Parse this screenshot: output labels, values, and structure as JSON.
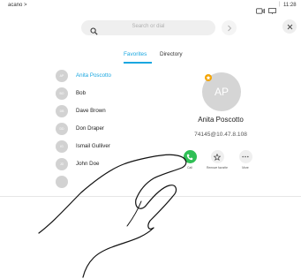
{
  "status_bar": {
    "brand": "acano >",
    "separator": "|",
    "time": "11:28"
  },
  "search": {
    "placeholder": "Search or dial"
  },
  "tabs": [
    {
      "label": "Favorites",
      "active": true
    },
    {
      "label": "Directory",
      "active": false
    }
  ],
  "contacts": [
    {
      "initials": "AP",
      "name": "Anita Poscotto",
      "selected": true
    },
    {
      "initials": "BO",
      "name": "Bob",
      "selected": false
    },
    {
      "initials": "DB",
      "name": "Dave Brown",
      "selected": false
    },
    {
      "initials": "DD",
      "name": "Don Draper",
      "selected": false
    },
    {
      "initials": "IG",
      "name": "Ismail Gulliver",
      "selected": false
    },
    {
      "initials": "JD",
      "name": "John Doe",
      "selected": false
    }
  ],
  "detail": {
    "initials": "AP",
    "name": "Anita Poscotto",
    "address": "74145@10.47.8.108",
    "actions": {
      "call": "Call",
      "favorite": "Remove favorite",
      "more": "More"
    }
  },
  "colors": {
    "accent": "#1aa7e0",
    "call_green": "#2fbf55",
    "favorite_badge": "#f4a300"
  },
  "icons": [
    "camera-icon",
    "present-icon",
    "search-icon",
    "chevron-right-icon",
    "close-icon",
    "star-icon",
    "ellipsis-icon"
  ]
}
